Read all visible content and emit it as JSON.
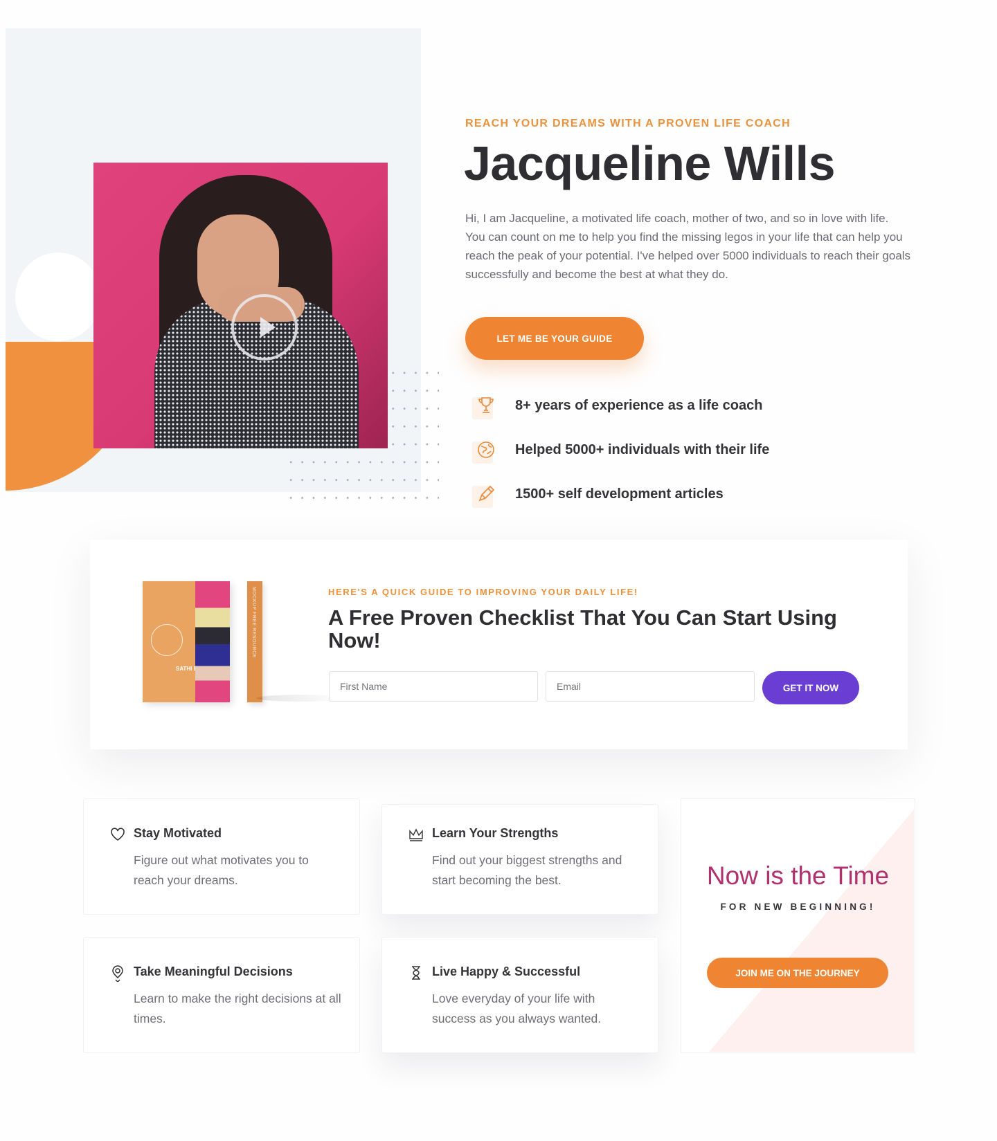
{
  "hero": {
    "eyebrow": "REACH YOUR DREAMS WITH A PROVEN LIFE COACH",
    "title": "Jacqueline Wills",
    "description_line1": "Hi, I am Jacqueline, a motivated life coach, mother of two, and so in love with life.",
    "description_line2": "You can count on me to help you find the missing legos in your life that can help you reach the peak of your potential. I've helped over 5000 individuals to reach their goals successfully and become the best at what they do.",
    "cta_label": "LET ME BE YOUR GUIDE",
    "features": [
      {
        "icon": "trophy-icon",
        "label": "8+ years of experience as a life coach"
      },
      {
        "icon": "globe-icon",
        "label": "Helped 5000+ individuals with their life"
      },
      {
        "icon": "pencil-icon",
        "label": "1500+ self development articles"
      }
    ]
  },
  "guide": {
    "book_cover_text": "SATHI BOOK",
    "book_spine_text": "MOCKUP FREE RESOURCE",
    "eyebrow": "HERE'S A QUICK GUIDE TO IMPROVING YOUR DAILY LIFE!",
    "title": "A Free Proven Checklist That You Can Start Using Now!",
    "first_name_placeholder": "First Name",
    "email_placeholder": "Email",
    "submit_label": "GET IT NOW"
  },
  "cards": [
    {
      "icon": "heart-icon",
      "title": "Stay Motivated",
      "description": "Figure out what motivates you to reach your dreams."
    },
    {
      "icon": "crown-icon",
      "title": "Learn Your Strengths",
      "description": "Find out your biggest strengths and start becoming the best."
    },
    {
      "icon": "location-pin-icon",
      "title": "Take Meaningful Decisions",
      "description": "Learn to make the right decisions at all times."
    },
    {
      "icon": "hourglass-icon",
      "title": "Live Happy & Successful",
      "description": "Love everyday of your life with success as you always wanted."
    }
  ],
  "promo": {
    "title": "Now is the Time",
    "subtitle": "FOR NEW BEGINNING!",
    "cta_label": "JOIN ME ON THE JOURNEY"
  },
  "colors": {
    "accent_orange": "#ef8432",
    "eyebrow_orange": "#ea913c",
    "accent_purple": "#6a3ed3",
    "promo_magenta": "#b1306e",
    "photo_pink": "#e0427c"
  }
}
